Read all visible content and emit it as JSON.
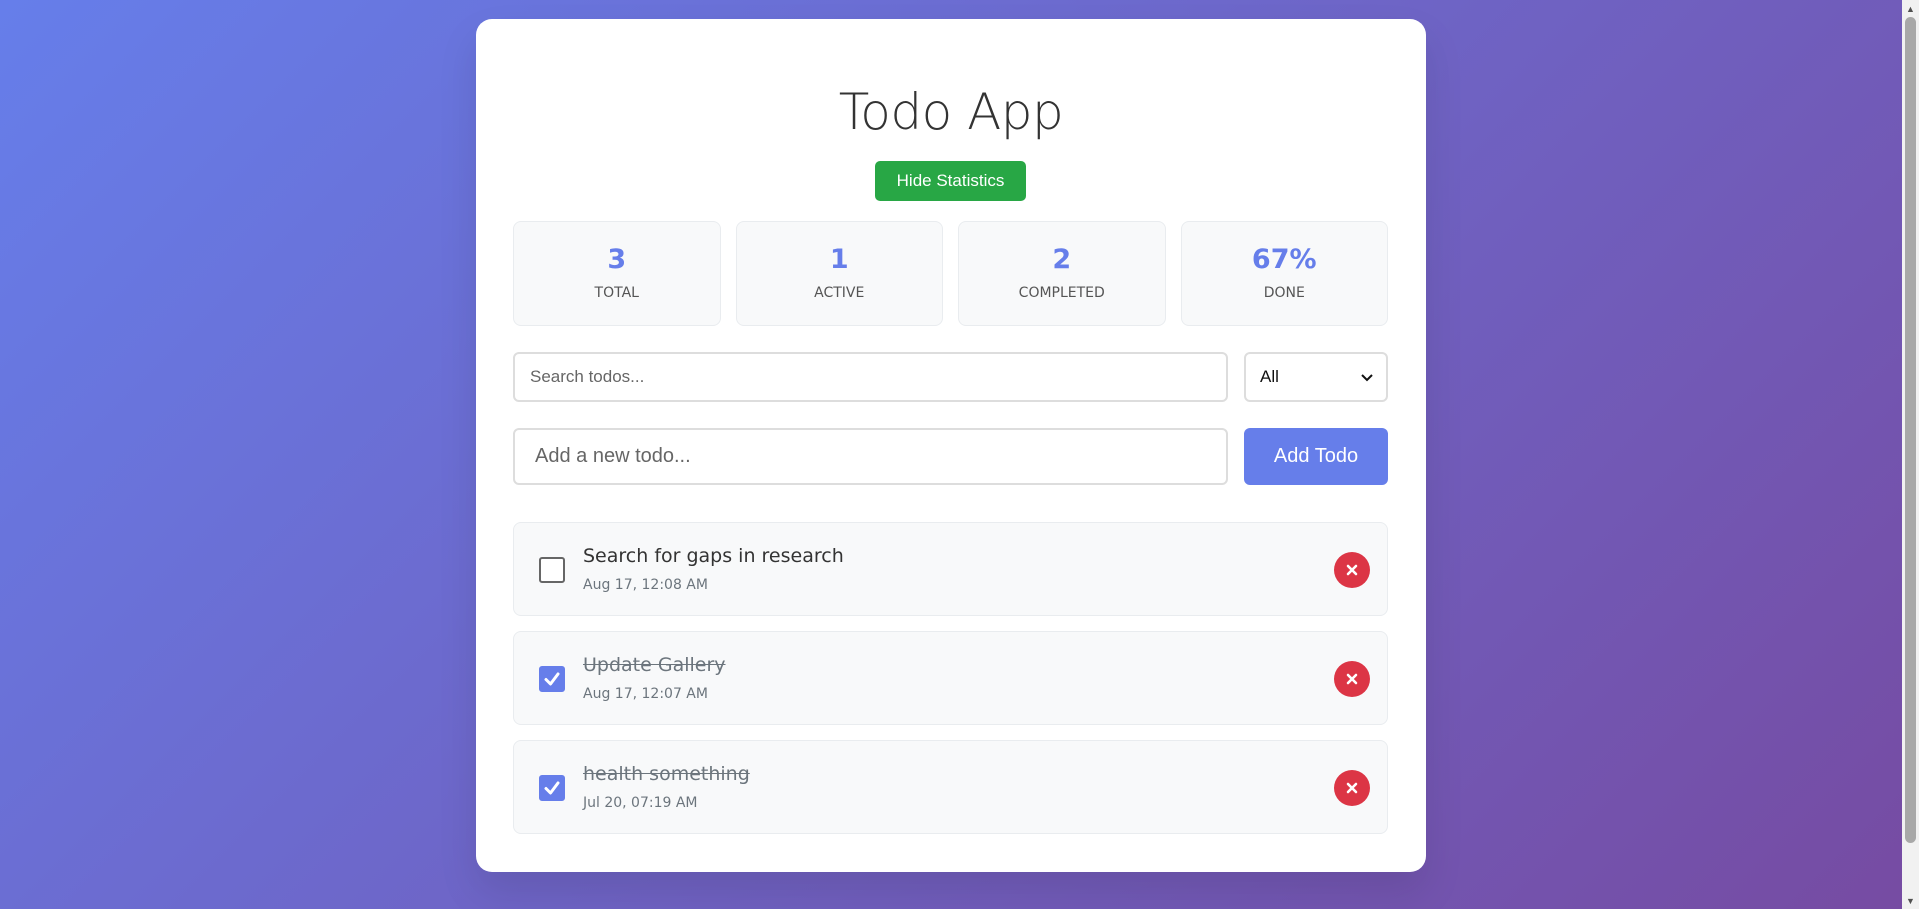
{
  "app": {
    "title": "Todo App",
    "toggle_stats_label": "Hide Statistics"
  },
  "stats": [
    {
      "value": "3",
      "label": "TOTAL"
    },
    {
      "value": "1",
      "label": "ACTIVE"
    },
    {
      "value": "2",
      "label": "COMPLETED"
    },
    {
      "value": "67%",
      "label": "DONE"
    }
  ],
  "search": {
    "placeholder": "Search todos...",
    "value": ""
  },
  "filter": {
    "selected": "All",
    "icon": "chevron-down-icon"
  },
  "new_todo": {
    "placeholder": "Add a new todo...",
    "value": "",
    "add_label": "Add Todo"
  },
  "todos": [
    {
      "text": "Search for gaps in research",
      "date": "Aug 17, 12:08 AM",
      "completed": false
    },
    {
      "text": "Update Gallery",
      "date": "Aug 17, 12:07 AM",
      "completed": true
    },
    {
      "text": "health something",
      "date": "Jul 20, 07:19 AM",
      "completed": true
    }
  ],
  "colors": {
    "accent": "#667eea",
    "success": "#28a745",
    "danger": "#dc3545",
    "background_start": "#667eea",
    "background_end": "#764ba2"
  },
  "icons": {
    "check": "check-icon",
    "delete": "close-icon"
  }
}
